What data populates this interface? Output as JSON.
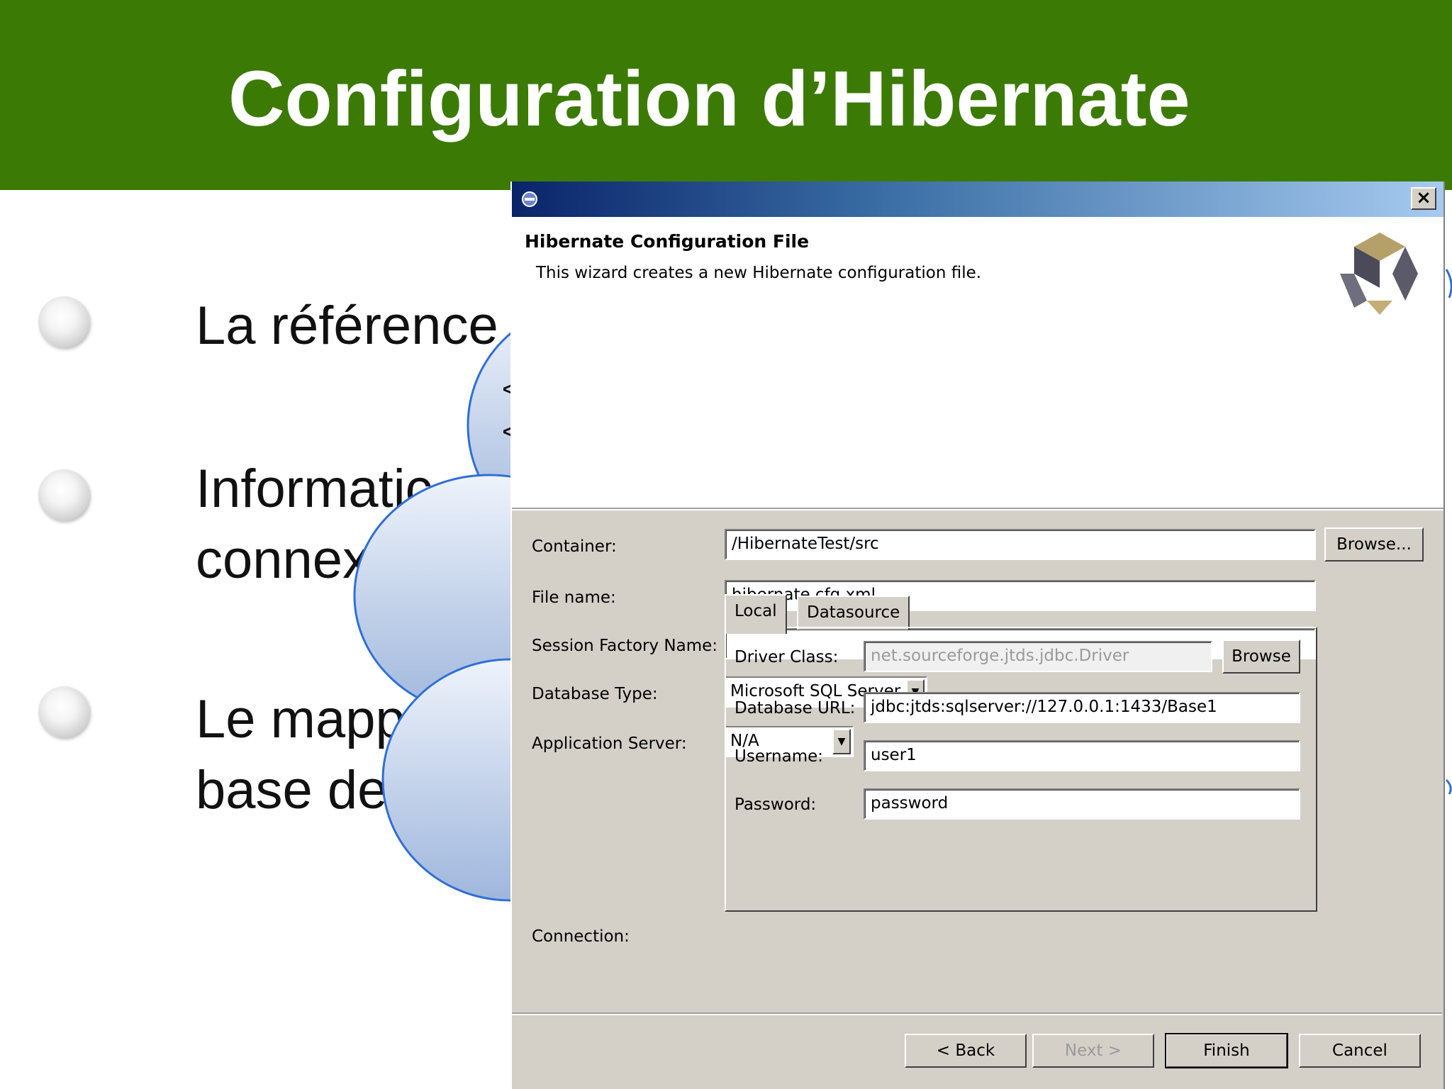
{
  "slide": {
    "title": "Configuration d’Hibernate",
    "bullets": [
      {
        "lines": [
          "La référence"
        ]
      },
      {
        "lines": [
          "Informatic",
          "connex"
        ]
      },
      {
        "lines": [
          "Le mapp",
          "base de"
        ]
      }
    ],
    "cloud_fragment": "<"
  },
  "dialog": {
    "close_label": "×",
    "banner_title": "Hibernate Configuration File",
    "banner_desc": "This wizard creates a new Hibernate configuration file.",
    "container": {
      "label": "Container:",
      "value": "/HibernateTest/src",
      "browse": "Browse..."
    },
    "file_name": {
      "label": "File name:",
      "value": "hibernate.cfg.xml"
    },
    "session_factory": {
      "label": "Session Factory Name:",
      "value": ""
    },
    "database_type": {
      "label": "Database Type:",
      "value": "Microsoft SQL Server"
    },
    "application_server": {
      "label": "Application Server:",
      "value": "N/A"
    },
    "connection_label": "Connection:",
    "tabs": [
      "Local",
      "Datasource"
    ],
    "driver_class": {
      "label": "Driver Class:",
      "value": "net.sourceforge.jtds.jdbc.Driver",
      "browse": "Browse"
    },
    "database_url": {
      "label": "Database URL:",
      "value": "jdbc:jtds:sqlserver://127.0.0.1:1433/Base1"
    },
    "username": {
      "label": "Username:",
      "value": "user1"
    },
    "password": {
      "label": "Password:",
      "value": "password"
    },
    "buttons": {
      "back": "< Back",
      "next": "Next >",
      "finish": "Finish",
      "cancel": "Cancel"
    }
  },
  "colors": {
    "slide_header": "#3c7a06",
    "dialog_face": "#d4d0c8",
    "cloud_stroke": "#2f6fd6"
  }
}
